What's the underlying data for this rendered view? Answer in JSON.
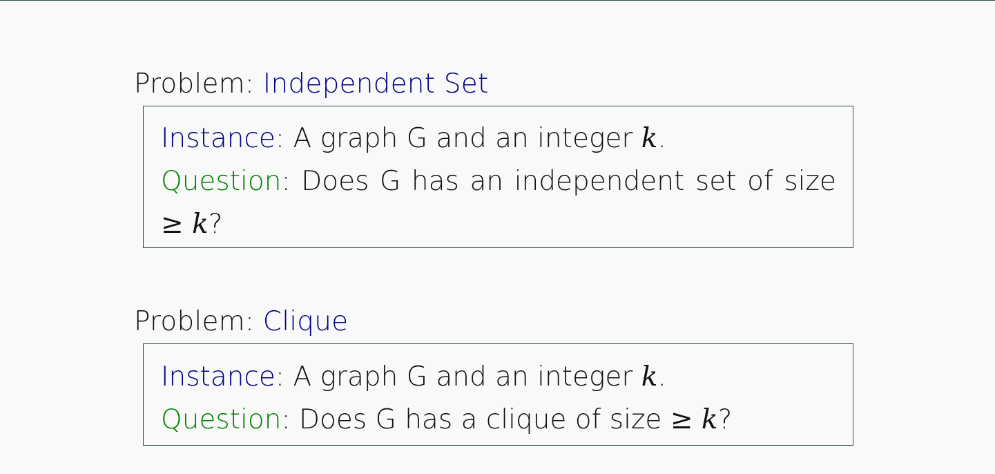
{
  "problems": [
    {
      "label": "Problem:",
      "name": "Independent Set",
      "instance_label": "Instance",
      "instance_text": "A graph G and an integer ",
      "instance_var": "k",
      "instance_end": ".",
      "question_label": "Question",
      "question_line1_words": [
        "Does",
        "G",
        "has",
        "an",
        "independent",
        "set",
        "of",
        "size"
      ],
      "question_line2_geq": "≥",
      "question_line2_var": "k",
      "question_line2_end": "?"
    },
    {
      "label": "Problem:",
      "name": "Clique",
      "instance_label": "Instance",
      "instance_text": "A graph G and an integer ",
      "instance_var": "k",
      "instance_end": ".",
      "question_label": "Question",
      "question_text": "Does G has a clique of size ",
      "question_geq": "≥",
      "question_var": "k",
      "question_end": "?"
    }
  ]
}
